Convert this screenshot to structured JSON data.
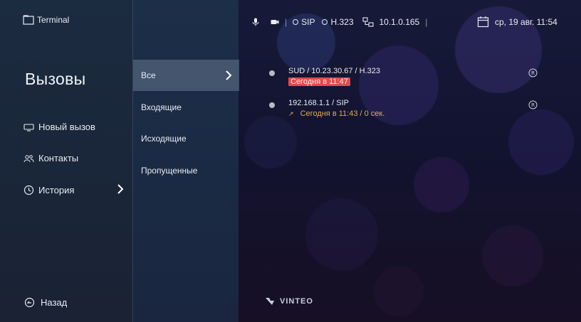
{
  "app": {
    "title": "Terminal"
  },
  "page": {
    "title": "Вызовы"
  },
  "sidebar": {
    "items": [
      {
        "label": "Новый вызов",
        "icon": "display-icon"
      },
      {
        "label": "Контакты",
        "icon": "contacts-icon"
      },
      {
        "label": "История",
        "icon": "clock-icon"
      }
    ],
    "back_label": "Назад"
  },
  "tabs": [
    {
      "label": "Все",
      "active": true
    },
    {
      "label": "Входящие"
    },
    {
      "label": "Исходящие"
    },
    {
      "label": "Пропущенные"
    }
  ],
  "status": {
    "sip": "SIP",
    "h323": "H.323",
    "ip": "10.1.0.165",
    "date": "ср, 19 авг. 11:54"
  },
  "calls": [
    {
      "title": "SUD / 10.23.30.67 / H.323",
      "detail": "Сегодня в 11:47",
      "type": "missed"
    },
    {
      "title": "192.168.1.1 / SIP",
      "detail": "Сегодня в 11:43 / 0 сек.",
      "type": "outgoing"
    }
  ],
  "brand": {
    "logo_text": "VINTEO"
  },
  "colors": {
    "missed": "#e24a51",
    "outgoing": "#e0a85a",
    "active_tab": "#6f7d94"
  }
}
